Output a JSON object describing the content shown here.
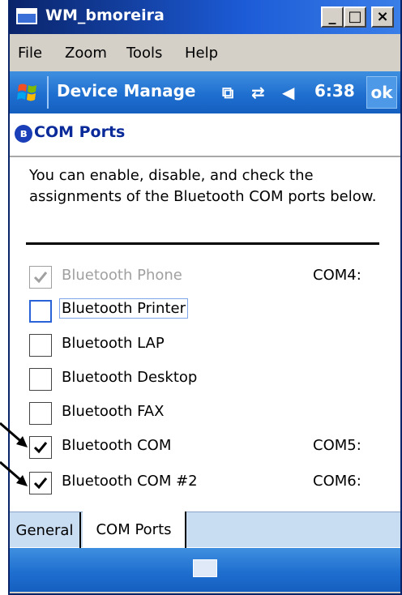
{
  "window": {
    "title": "WM_bmoreira",
    "buttons": {
      "minimize": "_",
      "maximize": "□",
      "close": "×"
    }
  },
  "menu": {
    "items": [
      "File",
      "Zoom",
      "Tools",
      "Help"
    ]
  },
  "taskbar": {
    "title": "Device Manage",
    "time": "6:38",
    "ok_label": "ok",
    "icons": [
      "copy-icon",
      "connectivity-icon",
      "volume-icon"
    ]
  },
  "page": {
    "title": "COM Ports",
    "description": "You can enable, disable, and check the assignments of the Bluetooth COM ports below."
  },
  "ports": [
    {
      "label": "Bluetooth Phone",
      "checked": true,
      "disabled": true,
      "com": "COM4:"
    },
    {
      "label": "Bluetooth Printer",
      "checked": false,
      "focused": true,
      "com": ""
    },
    {
      "label": "Bluetooth LAP",
      "checked": false,
      "com": ""
    },
    {
      "label": "Bluetooth Desktop",
      "checked": false,
      "com": ""
    },
    {
      "label": "Bluetooth FAX",
      "checked": false,
      "com": ""
    },
    {
      "label": "Bluetooth COM",
      "checked": true,
      "com": "COM5:"
    },
    {
      "label": "Bluetooth COM #2",
      "checked": true,
      "com": "COM6:"
    }
  ],
  "tabs": [
    {
      "label": "General",
      "active": false
    },
    {
      "label": "COM Ports",
      "active": true
    }
  ],
  "colors": {
    "taskbar": "#1f6fd0",
    "title_text": "#0a2a9a",
    "accent_focus": "#2a62d8"
  }
}
